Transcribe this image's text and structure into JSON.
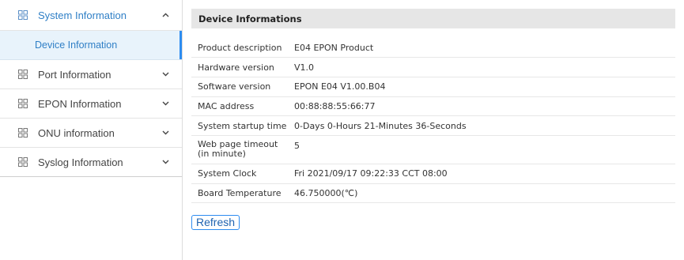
{
  "sidebar": {
    "items": [
      {
        "label": "System Information",
        "icon": "grid-icon",
        "expanded": true
      },
      {
        "label": "Port Information",
        "icon": "grid-icon",
        "expanded": false
      },
      {
        "label": "EPON Information",
        "icon": "grid-icon",
        "expanded": false
      },
      {
        "label": "ONU information",
        "icon": "grid-icon",
        "expanded": false
      },
      {
        "label": "Syslog Information",
        "icon": "grid-icon",
        "expanded": false
      }
    ],
    "subitems": [
      {
        "label": "Device Information",
        "selected": true
      }
    ],
    "accent_color": "#2d8cf0"
  },
  "main": {
    "title": "Device Informations",
    "rows": [
      {
        "key": "Product description",
        "value": "E04 EPON Product"
      },
      {
        "key": "Hardware version",
        "value": "V1.0"
      },
      {
        "key": "Software version",
        "value": "EPON E04 V1.00.B04"
      },
      {
        "key": "MAC address",
        "value": "00:88:88:55:66:77"
      },
      {
        "key": "System startup time",
        "value": "0-Days 0-Hours 21-Minutes 36-Seconds"
      },
      {
        "key_line1": "Web page timeout",
        "key_line2": "(in minute)",
        "value": "5"
      },
      {
        "key": "System Clock",
        "value": "Fri 2021/09/17 09:22:33 CCT 08:00"
      },
      {
        "key": "Board Temperature",
        "value": "46.750000(℃)"
      }
    ],
    "refresh_label": "Refresh"
  }
}
